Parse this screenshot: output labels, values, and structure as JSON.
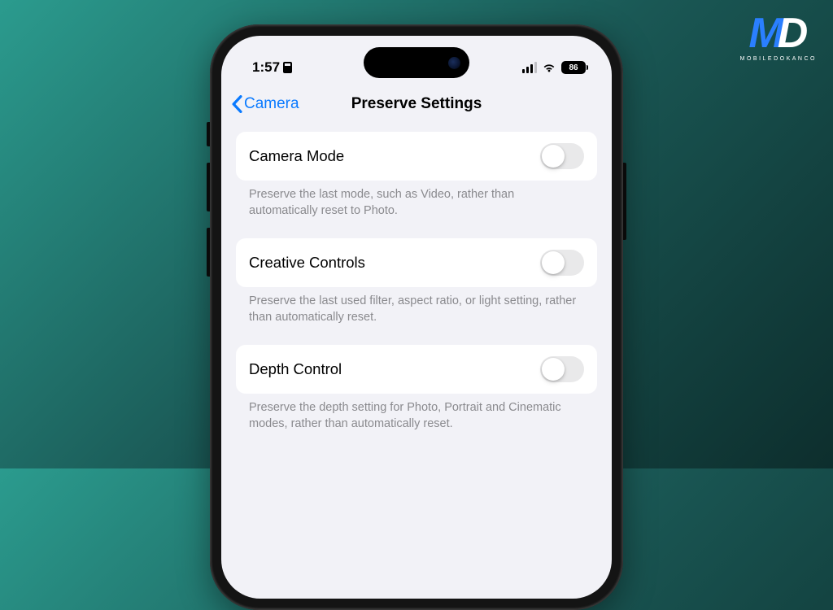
{
  "watermark": {
    "m": "M",
    "d": "D",
    "text": "MOBILEDOKANCO"
  },
  "status": {
    "time": "1:57",
    "battery_pct": "86"
  },
  "nav": {
    "back_label": "Camera",
    "title": "Preserve Settings"
  },
  "settings": [
    {
      "label": "Camera Mode",
      "description": "Preserve the last mode, such as Video, rather than automatically reset to Photo.",
      "on": false
    },
    {
      "label": "Creative Controls",
      "description": "Preserve the last used filter, aspect ratio, or light setting, rather than automatically reset.",
      "on": false
    },
    {
      "label": "Depth Control",
      "description": "Preserve the depth setting for Photo, Portrait and Cinematic modes, rather than automatically reset.",
      "on": false
    }
  ]
}
